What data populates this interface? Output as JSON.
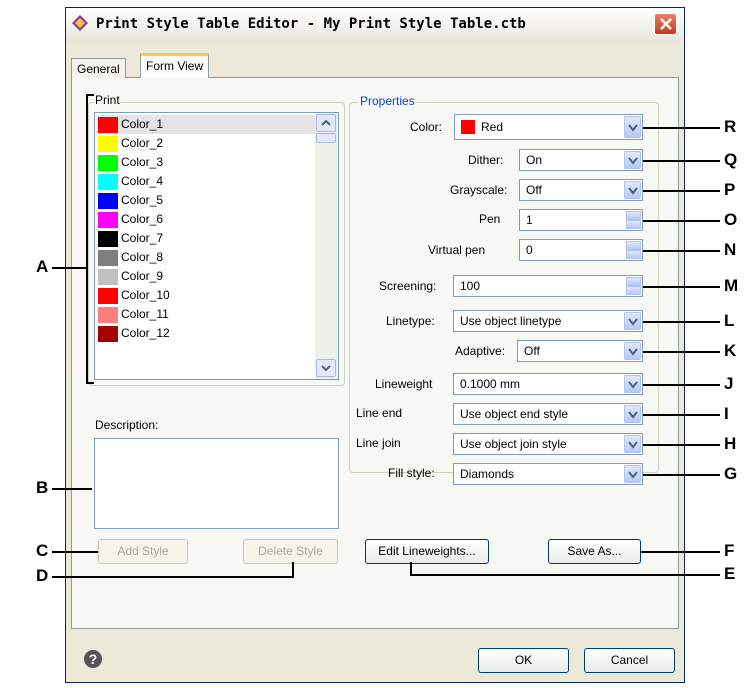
{
  "title": "Print Style Table Editor - My Print Style Table.ctb",
  "tabs": [
    {
      "label": "General"
    },
    {
      "label": "Form View"
    }
  ],
  "print_label": "Print",
  "styles": [
    {
      "name": "Color_1",
      "color": "#ff0000"
    },
    {
      "name": "Color_2",
      "color": "#ffff00"
    },
    {
      "name": "Color_3",
      "color": "#00ff00"
    },
    {
      "name": "Color_4",
      "color": "#00ffff"
    },
    {
      "name": "Color_5",
      "color": "#0000ff"
    },
    {
      "name": "Color_6",
      "color": "#ff00ff"
    },
    {
      "name": "Color_7",
      "color": "#000000"
    },
    {
      "name": "Color_8",
      "color": "#808080"
    },
    {
      "name": "Color_9",
      "color": "#c0c0c0"
    },
    {
      "name": "Color_10",
      "color": "#ff0000"
    },
    {
      "name": "Color_11",
      "color": "#ff7f7f"
    },
    {
      "name": "Color_12",
      "color": "#a50000"
    }
  ],
  "description_label": "Description:",
  "properties": {
    "group_label": "Properties",
    "color": {
      "label": "Color:",
      "value": "Red",
      "swatch": "#ff0000"
    },
    "dither": {
      "label": "Dither:",
      "value": "On"
    },
    "grayscale": {
      "label": "Grayscale:",
      "value": "Off"
    },
    "pen": {
      "label": "Pen",
      "value": "1"
    },
    "virtual_pen": {
      "label": "Virtual pen",
      "value": "0"
    },
    "screening": {
      "label": "Screening:",
      "value": "100"
    },
    "linetype": {
      "label": "Linetype:",
      "value": "Use object linetype"
    },
    "adaptive": {
      "label": "Adaptive:",
      "value": "Off"
    },
    "lineweight": {
      "label": "Lineweight",
      "value": "0.1000 mm"
    },
    "line_end": {
      "label": "Line end",
      "value": "Use object end style"
    },
    "line_join": {
      "label": "Line join",
      "value": "Use object join style"
    },
    "fill_style": {
      "label": "Fill style:",
      "value": "Diamonds"
    }
  },
  "buttons": {
    "add_style": "Add Style",
    "delete_style": "Delete Style",
    "edit_lineweights": "Edit Lineweights...",
    "save_as": "Save As...",
    "ok": "OK",
    "cancel": "Cancel"
  },
  "callouts": {
    "left": [
      "A",
      "B",
      "C",
      "D"
    ],
    "right": [
      "R",
      "Q",
      "P",
      "O",
      "N",
      "M",
      "L",
      "K",
      "J",
      "I",
      "H",
      "G",
      "F",
      "E"
    ]
  },
  "colors": {
    "accent_tab": "#ffc83c",
    "title_close": "#c4391c",
    "field_border": "#7f9db9"
  },
  "icons": [
    "app-icon",
    "close-icon",
    "help-icon",
    "chevron-down-icon",
    "spin-up-icon",
    "spin-down-icon"
  ]
}
